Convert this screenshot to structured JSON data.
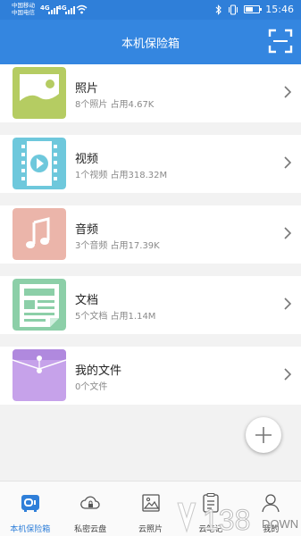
{
  "status_bar": {
    "carrier_1": "中国移动",
    "carrier_2": "中国电信",
    "signal_1": "4G",
    "signal_2": "4G",
    "time": "15:46",
    "icons": [
      "signal-icon",
      "wifi-icon",
      "bluetooth-icon",
      "vibrate-icon",
      "battery-icon"
    ],
    "battery_level": 0.55
  },
  "header": {
    "title": "本机保险箱",
    "scan_icon": "scan-icon"
  },
  "categories": [
    {
      "title": "照片",
      "subtitle": "8个照片 占用4.67K",
      "icon": "photo-icon",
      "color": "#b5cc62"
    },
    {
      "title": "视频",
      "subtitle": "1个视频 占用318.32M",
      "icon": "video-icon",
      "color": "#6ec8dc"
    },
    {
      "title": "音频",
      "subtitle": "3个音频 占用17.39K",
      "icon": "music-icon",
      "color": "#ebb5aa"
    },
    {
      "title": "文档",
      "subtitle": "5个文档 占用1.14M",
      "icon": "document-icon",
      "color": "#8ccfa8"
    },
    {
      "title": "我的文件",
      "subtitle": "0个文件",
      "icon": "folder-icon",
      "color": "#c6a2ea"
    }
  ],
  "fab": {
    "icon": "plus-icon"
  },
  "bottom_nav": [
    {
      "label": "本机保险箱",
      "icon": "safe-icon",
      "active": true
    },
    {
      "label": "私密云盘",
      "icon": "cloud-lock-icon",
      "active": false
    },
    {
      "label": "云照片",
      "icon": "image-icon",
      "active": false
    },
    {
      "label": "云笔记",
      "icon": "note-icon",
      "active": false
    },
    {
      "label": "我的",
      "icon": "person-icon",
      "active": false
    }
  ],
  "watermark": {
    "text": "138",
    "suffix": "DOWN"
  },
  "colors": {
    "header": "#3486e0",
    "status_bar": "#2f7fd9",
    "active_nav": "#2f7fd9"
  }
}
